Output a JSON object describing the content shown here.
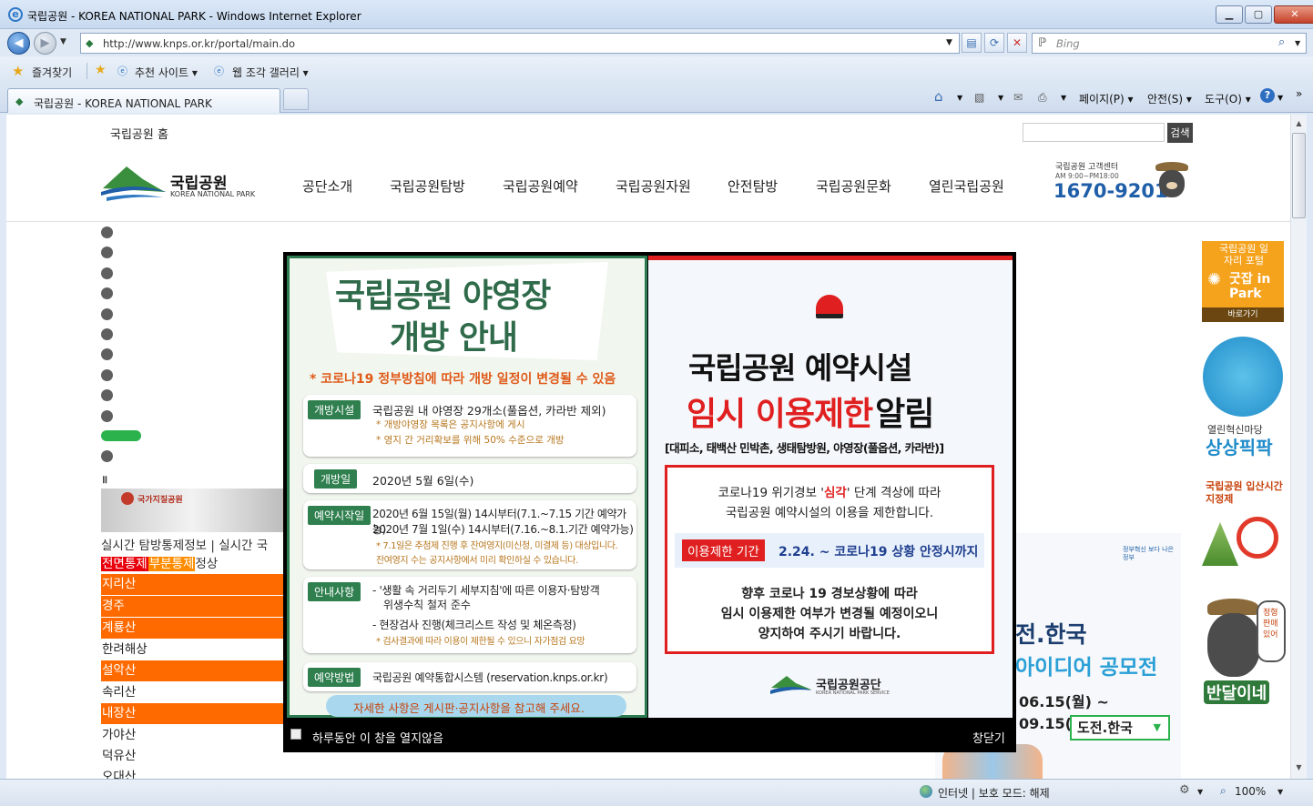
{
  "window": {
    "title": "국립공원 - KOREA NATIONAL PARK - Windows Internet Explorer",
    "minimize": "▁",
    "maximize": "▢",
    "close": "✕"
  },
  "addressbar": {
    "url": "http://www.knps.or.kr/portal/main.do",
    "search_placeholder": "Bing"
  },
  "favorites": {
    "favorites_label": "즐겨찾기",
    "suggested_sites": "추천 사이트 ▾",
    "web_slice_gallery": "웹 조각 갤러리 ▾"
  },
  "tab": {
    "label": "국립공원 - KOREA NATIONAL PARK"
  },
  "commandbar": {
    "page": "페이지(P) ▾",
    "safety": "안전(S) ▾",
    "tools": "도구(O) ▾"
  },
  "site": {
    "home_link": "국립공원 홈",
    "search_button": "검색",
    "logo_text": "국립공원",
    "logo_sub": "KOREA NATIONAL PARK",
    "nav": [
      "공단소개",
      "국립공원탐방",
      "국립공원예약",
      "국립공원자원",
      "안전탐방",
      "국립공원문화",
      "열린국립공원"
    ],
    "callcenter_label": "국립공원 고객센터",
    "callcenter_hours": "AM 9:00~PM18:00",
    "callcenter_number": "1670-9201",
    "pause_icon": "॥",
    "geopark_label": "국가지질공원",
    "status_header": "실시간 탐방통제정보 | 실시간 국",
    "legend": {
      "full": "전면통제",
      "partial": "부분통제",
      "normal": "정상"
    },
    "parks": [
      {
        "name": "지리산",
        "status": "orange"
      },
      {
        "name": "경주",
        "status": "orange"
      },
      {
        "name": "계룡산",
        "status": "orange"
      },
      {
        "name": "한려해상",
        "status": "normal"
      },
      {
        "name": "설악산",
        "status": "orange"
      },
      {
        "name": "속리산",
        "status": "normal"
      },
      {
        "name": "내장산",
        "status": "orange"
      },
      {
        "name": "가야산",
        "status": "normal"
      },
      {
        "name": "덕유산",
        "status": "normal"
      },
      {
        "name": "오대산",
        "status": "normal"
      }
    ],
    "bg_banner": {
      "logo": "정부혁신 보다 나은 정부",
      "title": "전.한국",
      "subtitle": "아이디어 공모전",
      "dates": "06.15(월) ~ 09.15(화)",
      "select": "도전.한국"
    },
    "right_banners": {
      "jobs_title": "국립공원 일자리 포털",
      "jobs_brand": "굿잡 in Park",
      "jobs_go": "바로가기",
      "innovation_label": "열린혁신마당",
      "innovation_brand": "상상픽팍",
      "entry_title": "국립공원 입산시간지정제",
      "bear_name": "반달이네",
      "bear_bubble": "정형 판매 있어"
    }
  },
  "popup": {
    "left": {
      "title1": "국립공원 야영장",
      "title2": "개방 안내",
      "notice": "* 코로나19 정부방침에 따라 개방 일정이 변경될 수 있음",
      "rows": [
        {
          "tag": "개방시설",
          "lines": [
            "국립공원 내 야영장 29개소(풀옵션, 카라반 제외)"
          ],
          "notes": [
            "* 개방야영장 목록은 공지사항에 게시",
            "* 영지 간 거리확보를 위해 50% 수준으로 개방"
          ]
        },
        {
          "tag": "개방일",
          "lines": [
            "2020년 5월 6일(수)"
          ],
          "notes": []
        },
        {
          "tag": "예약시작일",
          "lines": [
            "2020년 6월 15일(월) 14시부터(7.1.~7.15 기간 예약가능)",
            "2020년 7월 1일(수) 14시부터(7.16.~8.1.기간 예약가능)"
          ],
          "notes": [
            "* 7.1일은 추첨제 진행 후 잔여영지(미신청, 미결제 등) 대상입니다.",
            "잔여영지 수는 공지사항에서 미리 확인하실 수 있습니다."
          ]
        },
        {
          "tag": "안내사항",
          "lines": [
            "- '생활 속 거리두기 세부지침'에 따른 이용자·탐방객",
            "위생수칙 철저 준수",
            "- 현장검사 진행(체크리스트 작성 및 체온측정)"
          ],
          "notes": [
            "* 검사결과에 따라 이용이 제한될 수 있으니 자가점검 요망"
          ]
        },
        {
          "tag": "예약방법",
          "lines": [
            "국립공원 예약통합시스템 (reservation.knps.or.kr)"
          ],
          "notes": []
        }
      ],
      "footer": "자세한 사항은 게시판·공지사항을 참고해 주세요."
    },
    "right": {
      "title1": "국립공원 예약시설",
      "title2a": "임시 이용제한",
      "title2b": "알림",
      "subtitle": "[대피소, 태백산 민박촌, 생태탐방원, 야영장(풀옵션, 카라반)]",
      "para1a": "코로나19 위기경보 '",
      "para1_em": "심각",
      "para1b": "' 단계 격상에 따라",
      "para2": "국립공원 예약시설의 이용을 제한합니다.",
      "period_label": "이용제한 기간",
      "period_value": "2.24. ~ 코로나19 상황 안정시까지",
      "para3": "향후 코로나 19 경보상황에 따라",
      "para4": "임시 이용제한 여부가 변경될 예정이오니",
      "para5": "양지하여 주시기 바랍니다.",
      "org": "국립공원공단",
      "org_sub": "KOREA NATIONAL PARK SERVICE"
    },
    "checkbox_label": "하루동안 이 창을 열지않음",
    "close_label": "창닫기"
  },
  "statusbar": {
    "zone": "인터넷 | 보호 모드: 해제",
    "zoom": "100%"
  },
  "colors": {
    "orange": "#ff6a00",
    "green": "#2c7a4f",
    "red": "#e02020",
    "blue": "#1f5ea8"
  }
}
